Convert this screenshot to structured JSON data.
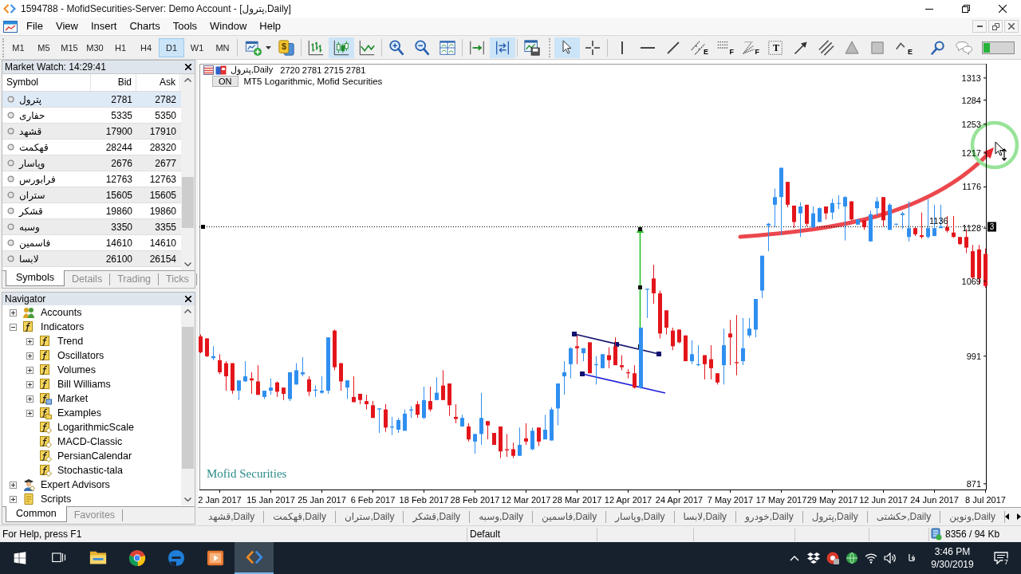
{
  "title_bar": {
    "title": "1594788 - MofidSecurities-Server: Demo Account - [پترول,Daily]"
  },
  "menu": [
    "File",
    "View",
    "Insert",
    "Charts",
    "Tools",
    "Window",
    "Help"
  ],
  "toolbar": {
    "timeframes": [
      {
        "label": "M1",
        "selected": false
      },
      {
        "label": "M5",
        "selected": false
      },
      {
        "label": "M15",
        "selected": false
      },
      {
        "label": "M30",
        "selected": false
      },
      {
        "label": "H1",
        "selected": false
      },
      {
        "label": "H4",
        "selected": false
      },
      {
        "label": "D1",
        "selected": true
      },
      {
        "label": "W1",
        "selected": false
      },
      {
        "label": "MN",
        "selected": false
      }
    ],
    "tool_groups": [
      [
        {
          "kind": "new_chart",
          "selected": false
        },
        {
          "kind": "profiles",
          "selected": false,
          "badge": "$"
        }
      ],
      [
        {
          "kind": "bar_chart",
          "selected": false
        },
        {
          "kind": "candlesticks",
          "selected": true
        },
        {
          "kind": "line_chart",
          "selected": false
        }
      ],
      [
        {
          "kind": "zoom_in",
          "selected": false
        },
        {
          "kind": "zoom_out",
          "selected": false
        },
        {
          "kind": "tile_windows",
          "selected": false
        }
      ],
      [
        {
          "kind": "chart_shift",
          "selected": false
        },
        {
          "kind": "auto_scroll",
          "selected": true
        }
      ],
      [
        {
          "kind": "templates",
          "selected": false
        }
      ],
      [
        {
          "kind": "cursor",
          "selected": true
        },
        {
          "kind": "crosshair",
          "selected": false
        }
      ],
      [
        {
          "kind": "vertical_line",
          "selected": false
        },
        {
          "kind": "horizontal_line",
          "selected": false
        },
        {
          "kind": "trendline",
          "selected": false
        },
        {
          "kind": "equidistant_channel",
          "selected": false,
          "badge": "E"
        },
        {
          "kind": "fibonacci",
          "selected": false,
          "badge": "F"
        },
        {
          "kind": "fibonacci_fan",
          "selected": false,
          "badge": "F"
        },
        {
          "kind": "text",
          "selected": false,
          "badge": "T"
        },
        {
          "kind": "arrow",
          "selected": false
        },
        {
          "kind": "parallel_lines",
          "selected": false
        },
        {
          "kind": "triangle",
          "selected": false
        },
        {
          "kind": "rectangle",
          "selected": false
        },
        {
          "kind": "elliott_wave",
          "selected": false,
          "badge": "E"
        }
      ],
      [
        {
          "kind": "search",
          "selected": false
        },
        {
          "kind": "chat",
          "selected": false
        }
      ]
    ]
  },
  "market_watch": {
    "title": "Market Watch: 14:29:41",
    "columns": [
      "Symbol",
      "Bid",
      "Ask"
    ],
    "rows": [
      {
        "symbol": "پترول",
        "bid": "2781",
        "ask": "2782",
        "selected": true
      },
      {
        "symbol": "حفاری",
        "bid": "5335",
        "ask": "5350",
        "selected": false
      },
      {
        "symbol": "قشهد",
        "bid": "17900",
        "ask": "17910",
        "selected": false
      },
      {
        "symbol": "قهکمت",
        "bid": "28244",
        "ask": "28320",
        "selected": false
      },
      {
        "symbol": "وپاسار",
        "bid": "2676",
        "ask": "2677",
        "selected": false
      },
      {
        "symbol": "فرابورس",
        "bid": "12763",
        "ask": "12763",
        "selected": false
      },
      {
        "symbol": "ستران",
        "bid": "15605",
        "ask": "15605",
        "selected": false
      },
      {
        "symbol": "قشکر",
        "bid": "19860",
        "ask": "19860",
        "selected": false
      },
      {
        "symbol": "وسبه",
        "bid": "3350",
        "ask": "3355",
        "selected": false
      },
      {
        "symbol": "فاسمین",
        "bid": "14610",
        "ask": "14610",
        "selected": false
      },
      {
        "symbol": "لابسا",
        "bid": "26100",
        "ask": "26154",
        "selected": false
      }
    ],
    "tabs": [
      {
        "label": "Symbols",
        "selected": true
      },
      {
        "label": "Details",
        "selected": false
      },
      {
        "label": "Trading",
        "selected": false
      },
      {
        "label": "Ticks",
        "selected": false
      }
    ]
  },
  "navigator": {
    "title": "Navigator",
    "tree": [
      {
        "label": "Accounts",
        "kind": "accounts",
        "expanded": false
      },
      {
        "label": "Indicators",
        "kind": "folder",
        "expanded": true,
        "children": [
          {
            "label": "Trend",
            "kind": "folder",
            "expanded": false
          },
          {
            "label": "Oscillators",
            "kind": "folder",
            "expanded": false
          },
          {
            "label": "Volumes",
            "kind": "folder",
            "expanded": false
          },
          {
            "label": "Bill Williams",
            "kind": "folder",
            "expanded": false
          },
          {
            "label": "Market",
            "kind": "market",
            "expanded": false
          },
          {
            "label": "Examples",
            "kind": "examples",
            "expanded": false
          },
          {
            "label": "LogarithmicScale",
            "kind": "indicator"
          },
          {
            "label": "MACD-Classic",
            "kind": "indicator"
          },
          {
            "label": "PersianCalendar",
            "kind": "indicator"
          },
          {
            "label": "Stochastic-tala",
            "kind": "indicator"
          }
        ]
      },
      {
        "label": "Expert Advisors",
        "kind": "experts",
        "expanded": false
      },
      {
        "label": "Scripts",
        "kind": "scripts",
        "expanded": false
      }
    ],
    "tabs": [
      {
        "label": "Common",
        "selected": true
      },
      {
        "label": "Favorites",
        "selected": false
      }
    ]
  },
  "chart": {
    "symbol": "پترول,Daily",
    "ohlc": "2720 2781 2715 2781",
    "indicator": {
      "button": "ON",
      "name": "MT5 Logarithmic, Mofid Securities"
    },
    "footer_label": "Mofid Securities",
    "chart_data": [
      {
        "type": "candlestick",
        "categories": [
          null,
          null,
          null,
          "2 Jan 2017",
          null,
          null,
          null,
          null,
          null,
          null,
          null,
          "15 Jan 2017",
          null,
          null,
          null,
          null,
          null,
          null,
          null,
          "25 Jan 2017",
          null,
          null,
          null,
          null,
          null,
          null,
          null,
          "6 Feb 2017",
          null,
          null,
          null,
          null,
          null,
          null,
          null,
          "18 Feb 2017",
          null,
          null,
          null,
          null,
          null,
          null,
          null,
          "28 Feb 2017",
          null,
          null,
          null,
          null,
          null,
          null,
          null,
          "12 Mar 2017",
          null,
          null,
          null,
          null,
          null,
          null,
          null,
          "28 Mar 2017",
          null,
          null,
          null,
          null,
          null,
          null,
          null,
          "12 Apr 2017",
          null,
          null,
          null,
          null,
          null,
          null,
          null,
          "24 Apr 2017",
          null,
          null,
          null,
          null,
          null,
          null,
          null,
          "7 May 2017",
          null,
          null,
          null,
          null,
          null,
          null,
          null,
          "17 May 2017",
          null,
          null,
          null,
          null,
          null,
          null,
          null,
          "29 May 2017",
          null,
          null,
          null,
          null,
          null,
          null,
          null,
          "12 Jun 2017",
          null,
          null,
          null,
          null,
          null,
          null,
          null,
          "24 Jun 2017",
          null,
          null,
          null,
          null,
          null,
          null,
          null,
          "8 Jul 2017"
        ],
        "ohlc": [
          [
            1011,
            1013,
            994,
            995
          ],
          [
            1009,
            1009,
            990,
            991
          ],
          [
            989,
            1001,
            987,
            991
          ],
          [
            987,
            993,
            973,
            975
          ],
          [
            984,
            986,
            957,
            971
          ],
          [
            984,
            984,
            954,
            957
          ],
          [
            957,
            967,
            948,
            967
          ],
          [
            966,
            986,
            966,
            971
          ],
          [
            969,
            975,
            954,
            967
          ],
          [
            966,
            982,
            953,
            953
          ],
          [
            951,
            957,
            949,
            957
          ],
          [
            957,
            969,
            953,
            960
          ],
          [
            965,
            966,
            951,
            956
          ],
          [
            960,
            960,
            948,
            954
          ],
          [
            949,
            975,
            947,
            975
          ],
          [
            963,
            984,
            963,
            977
          ],
          [
            973,
            990,
            971,
            975
          ],
          [
            968,
            971,
            952,
            956
          ],
          [
            957,
            962,
            951,
            958
          ],
          [
            955,
            971,
            954,
            957
          ],
          [
            957,
            1010,
            954,
            1010
          ],
          [
            1017,
            1018,
            977,
            980
          ],
          [
            984,
            984,
            957,
            966
          ],
          [
            960,
            967,
            949,
            967
          ],
          [
            951,
            971,
            946,
            946
          ],
          [
            954,
            954,
            944,
            948
          ],
          [
            947,
            953,
            939,
            944
          ],
          [
            943,
            947,
            931,
            931
          ],
          [
            939,
            940,
            917,
            940
          ],
          [
            939,
            944,
            918,
            922
          ],
          [
            922,
            932,
            915,
            923
          ],
          [
            920,
            931,
            917,
            929
          ],
          [
            919,
            939,
            919,
            935
          ],
          [
            938,
            942,
            931,
            939
          ],
          [
            944,
            947,
            931,
            934
          ],
          [
            931,
            961,
            930,
            948
          ],
          [
            947,
            961,
            937,
            939
          ],
          [
            948,
            970,
            948,
            955
          ],
          [
            962,
            977,
            948,
            948
          ],
          [
            964,
            964,
            933,
            943
          ],
          [
            932,
            944,
            926,
            930
          ],
          [
            923,
            934,
            923,
            931
          ],
          [
            923,
            926,
            909,
            911
          ],
          [
            909,
            916,
            898,
            916
          ],
          [
            916,
            955,
            906,
            931
          ],
          [
            928,
            928,
            911,
            924
          ],
          [
            917,
            917,
            906,
            906
          ],
          [
            923,
            923,
            894,
            900
          ],
          [
            902,
            916,
            895,
            901
          ],
          [
            902,
            908,
            894,
            896
          ],
          [
            896,
            922,
            896,
            906
          ],
          [
            912,
            926,
            906,
            909
          ],
          [
            902,
            922,
            901,
            919
          ],
          [
            922,
            922,
            905,
            909
          ],
          [
            911,
            934,
            911,
            920
          ],
          [
            910,
            941,
            910,
            939
          ],
          [
            940,
            964,
            924,
            964
          ],
          [
            971,
            986,
            953,
            975
          ],
          [
            983,
            1000,
            969,
            999
          ],
          [
            1001,
            1012,
            983,
            999
          ],
          [
            994,
            999,
            986,
            999
          ],
          [
            1005,
            1005,
            974,
            974
          ],
          [
            982,
            991,
            963,
            983
          ],
          [
            979,
            993,
            979,
            993
          ],
          [
            992,
            1000,
            979,
            987
          ],
          [
            1001,
            1010,
            982,
            982
          ],
          [
            982,
            992,
            977,
            980
          ],
          [
            975,
            978,
            969,
            974
          ],
          [
            974,
            982,
            959,
            960
          ],
          [
            960,
            1020,
            959,
            1020
          ],
          [
            1060,
            1061,
            1030,
            1061
          ],
          [
            1072,
            1087,
            1045,
            1056
          ],
          [
            1056,
            1059,
            1009,
            1014
          ],
          [
            1038,
            1038,
            1013,
            1020
          ],
          [
            1017,
            1020,
            997,
            1001
          ],
          [
            1018,
            1018,
            1004,
            1005
          ],
          [
            1012,
            1012,
            986,
            986
          ],
          [
            986,
            1007,
            983,
            993
          ],
          [
            982,
            1002,
            981,
            983
          ],
          [
            992,
            992,
            968,
            983
          ],
          [
            988,
            1002,
            968,
            979
          ],
          [
            974,
            974,
            963,
            965
          ],
          [
            982,
            1019,
            963,
            1002
          ],
          [
            1014,
            1028,
            982,
            1010
          ],
          [
            985,
            1033,
            972,
            984
          ],
          [
            986,
            1030,
            982,
            999
          ],
          [
            1012,
            1030,
            1010,
            1019
          ],
          [
            1018,
            1050,
            1010,
            1050
          ],
          [
            1059,
            1097,
            1051,
            1097
          ],
          [
            1131,
            1134,
            1102,
            1133
          ],
          [
            1155,
            1174,
            1129,
            1164
          ],
          [
            1164,
            1199,
            1120,
            1199
          ],
          [
            1182,
            1182,
            1152,
            1155
          ],
          [
            1154,
            1154,
            1128,
            1135
          ],
          [
            1145,
            1158,
            1118,
            1153
          ],
          [
            1155,
            1155,
            1130,
            1133
          ],
          [
            1129,
            1153,
            1128,
            1145
          ],
          [
            1135,
            1152,
            1135,
            1151
          ],
          [
            1153,
            1153,
            1138,
            1145
          ],
          [
            1146,
            1162,
            1138,
            1157
          ],
          [
            1156,
            1166,
            1150,
            1157
          ],
          [
            1153,
            1165,
            1114,
            1164
          ],
          [
            1159,
            1159,
            1137,
            1138
          ],
          [
            1132,
            1138,
            1132,
            1138
          ],
          [
            1137,
            1137,
            1126,
            1129
          ],
          [
            1113,
            1148,
            1113,
            1144
          ],
          [
            1151,
            1164,
            1142,
            1159
          ],
          [
            1164,
            1164,
            1130,
            1137
          ],
          [
            1126,
            1157,
            1126,
            1155
          ],
          [
            1132,
            1133,
            1131,
            1133
          ],
          [
            1143,
            1147,
            1127,
            1145
          ],
          [
            1118,
            1159,
            1113,
            1128
          ],
          [
            1128,
            1129,
            1119,
            1121
          ],
          [
            1120,
            1146,
            1116,
            1118
          ],
          [
            1118,
            1162,
            1116,
            1128
          ],
          [
            1119,
            1155,
            1119,
            1128
          ],
          [
            1128,
            1155,
            1128,
            1130
          ],
          [
            1129,
            1142,
            1123,
            1125
          ],
          [
            1123,
            1142,
            1117,
            1118
          ],
          [
            1118,
            1118,
            1109,
            1110
          ],
          [
            1118,
            1127,
            1100,
            1106
          ],
          [
            1102,
            1109,
            1071,
            1073
          ],
          [
            1104,
            1109,
            1066,
            1072
          ],
          [
            1099,
            1105,
            1062,
            1064
          ]
        ],
        "log": true,
        "ylim": [
          866,
          1332
        ],
        "yticks": [
          871,
          991,
          1069,
          1128,
          1176,
          1217,
          1253,
          1284,
          1313
        ],
        "ref_lines": [
          {
            "axis": "y",
            "value": 1130,
            "color": "#000000",
            "line_style": "dotted"
          }
        ],
        "annotations": [
          "1136",
          "3"
        ]
      }
    ]
  },
  "chart_tabs": [
    {
      "label": "قشهد,Daily",
      "selected": false
    },
    {
      "label": "قهکمت,Daily",
      "selected": false
    },
    {
      "label": "ستران,Daily",
      "selected": false
    },
    {
      "label": "قشکر,Daily",
      "selected": false
    },
    {
      "label": "وسبه,Daily",
      "selected": false
    },
    {
      "label": "فاسمین,Daily",
      "selected": false
    },
    {
      "label": "وپاسار,Daily",
      "selected": false
    },
    {
      "label": "لابسا,Daily",
      "selected": false
    },
    {
      "label": "خودرو,Daily",
      "selected": false
    },
    {
      "label": "پترول,Daily",
      "selected": false
    },
    {
      "label": "حکشتی,Daily",
      "selected": false
    },
    {
      "label": "ونوین,Daily",
      "selected": false
    }
  ],
  "status_bar": {
    "help": "For Help, press F1",
    "profile": "Default",
    "traffic": "8356 / 94 Kb"
  },
  "taskbar": {
    "apps": [
      {
        "kind": "start",
        "selected": false
      },
      {
        "kind": "task_view",
        "selected": false
      },
      {
        "kind": "file_explorer",
        "selected": false
      },
      {
        "kind": "chrome",
        "selected": false
      },
      {
        "kind": "edge",
        "selected": false
      },
      {
        "kind": "media_player",
        "selected": false
      },
      {
        "kind": "metatrader",
        "selected": true
      }
    ],
    "language": "فا",
    "time": "3:46 PM",
    "date": "9/30/2019",
    "notifications": "7"
  }
}
